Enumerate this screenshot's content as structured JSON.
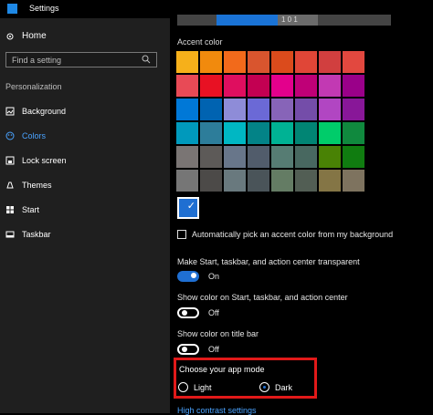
{
  "window": {
    "title": "Settings"
  },
  "sidebar": {
    "home_label": "Home",
    "search_placeholder": "Find a setting",
    "section_label": "Personalization",
    "items": [
      {
        "label": "Background",
        "icon": "image-icon",
        "active": false
      },
      {
        "label": "Colors",
        "icon": "palette-icon",
        "active": true
      },
      {
        "label": "Lock screen",
        "icon": "lock-screen-icon",
        "active": false
      },
      {
        "label": "Themes",
        "icon": "themes-icon",
        "active": false
      },
      {
        "label": "Start",
        "icon": "start-icon",
        "active": false
      },
      {
        "label": "Taskbar",
        "icon": "taskbar-icon",
        "active": false
      }
    ]
  },
  "main": {
    "top_segment_text": "1 0 1",
    "accent_title": "Accent color",
    "swatch_colors": [
      "#f6b01a",
      "#f18a0d",
      "#f26a1b",
      "#d9552e",
      "#db4b1c",
      "#e04637",
      "#d13f3f",
      "#e2483f",
      "#e84a56",
      "#e81123",
      "#df0e5f",
      "#c30052",
      "#e3008c",
      "#bf0077",
      "#c239b3",
      "#9a0089",
      "#0078d7",
      "#0063b1",
      "#8e8cd8",
      "#6b69d6",
      "#8764b8",
      "#744da9",
      "#b146c2",
      "#881798",
      "#0099bc",
      "#2d7d9a",
      "#00b7c3",
      "#038387",
      "#00b294",
      "#018574",
      "#00cc6a",
      "#10893e",
      "#7a7574",
      "#5d5a58",
      "#68768a",
      "#515c6b",
      "#567c73",
      "#486860",
      "#498205",
      "#107c10",
      "#767676",
      "#4c4a48",
      "#69797e",
      "#4a5459",
      "#647c64",
      "#525e54",
      "#847545",
      "#7e735f"
    ],
    "selected_swatch_color": "#1f6fd2",
    "checkbox_label": "Automatically pick an accent color from my background",
    "transparent_label": "Make Start, taskbar, and action center transparent",
    "transparent_state": "On",
    "show_color_start_label": "Show color on Start, taskbar, and action center",
    "show_color_start_state": "Off",
    "show_color_title_label": "Show color on title bar",
    "show_color_title_state": "Off",
    "app_mode": {
      "title": "Choose your app mode",
      "options": [
        "Light",
        "Dark"
      ],
      "selected": "Dark"
    },
    "link_text": "High contrast settings"
  },
  "colors": {
    "accent": "#1f6fd2",
    "highlight_box": "#e11919",
    "link": "#4aa3ff"
  }
}
